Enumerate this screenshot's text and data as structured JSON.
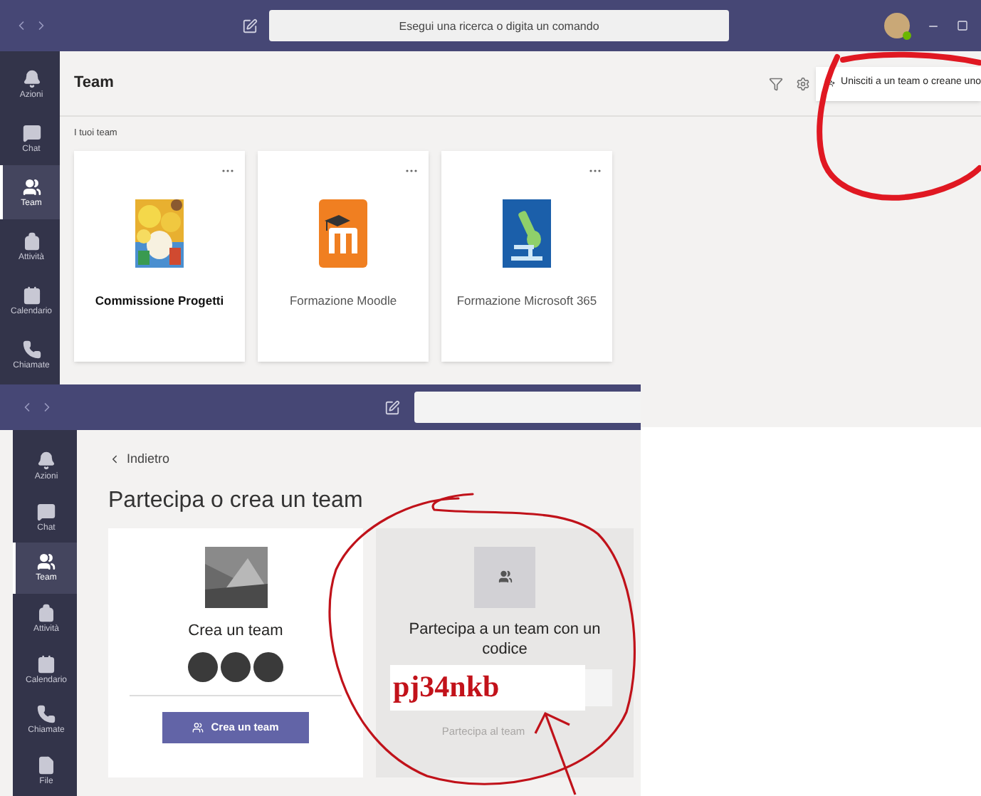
{
  "top_window": {
    "search": {
      "placeholder": "Esegui una ricerca o digita un comando"
    },
    "sidebar": [
      {
        "label": "Azioni",
        "selected": false
      },
      {
        "label": "Chat",
        "selected": false
      },
      {
        "label": "Team",
        "selected": true
      },
      {
        "label": "Attività",
        "selected": false
      },
      {
        "label": "Calendario",
        "selected": false
      },
      {
        "label": "Chiamate",
        "selected": false
      }
    ],
    "title": "Team",
    "join_button": "Unisciti a un team o creane uno",
    "section_label": "I tuoi team",
    "teams": [
      {
        "name": "Commissione Progetti",
        "unread": true,
        "kind": "picture"
      },
      {
        "name": "Formazione Moodle",
        "unread": false,
        "kind": "moodle"
      },
      {
        "name": "Formazione Microsoft 365",
        "unread": false,
        "kind": "microscope"
      }
    ]
  },
  "bottom_window": {
    "sidebar": [
      {
        "label": "Azioni",
        "selected": false
      },
      {
        "label": "Chat",
        "selected": false
      },
      {
        "label": "Team",
        "selected": true
      },
      {
        "label": "Attività",
        "selected": false
      },
      {
        "label": "Calendario",
        "selected": false
      },
      {
        "label": "Chiamate",
        "selected": false
      },
      {
        "label": "File",
        "selected": false
      }
    ],
    "back_link": "Indietro",
    "heading": "Partecipa o crea un team",
    "create_card": {
      "title": "Crea un team",
      "button": "Crea un team"
    },
    "join_card": {
      "title": "Partecipa a un team con un codice",
      "button": {
        "label": "Partecipa al team",
        "disabled": true
      }
    }
  },
  "annotation": {
    "code": "pj34nkb"
  }
}
